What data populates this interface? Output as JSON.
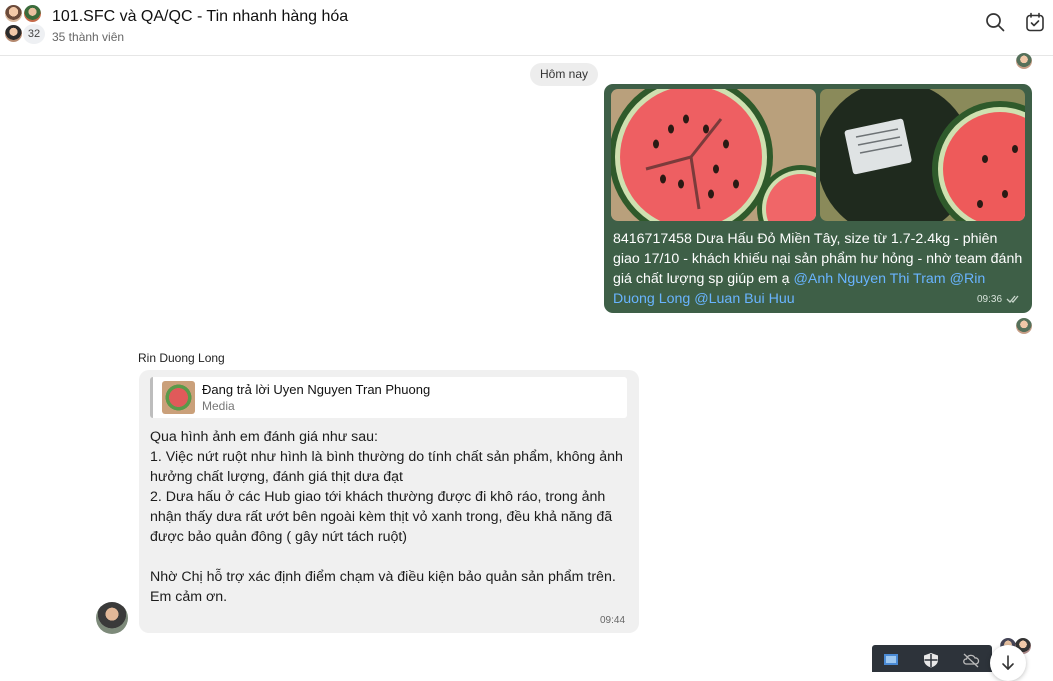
{
  "header": {
    "title": "101.SFC và QA/QC - Tin nhanh hàng hóa",
    "member_count_badge": "32",
    "subtitle": "35 thành viên",
    "icons": [
      "search-icon",
      "calendar-check-icon"
    ]
  },
  "day_separator": "Hôm nay",
  "outgoing_message": {
    "text_before_mention": "8416717458 Dưa Hấu Đỏ Miền Tây, size từ 1.7-2.4kg     - phiên giao 17/10 - khách khiếu nại sản phẩm hư hỏng - nhờ team đánh giá chất lượng sp giúp em ạ ",
    "mentions": "@Anh Nguyen Thi Tram @Rin Duong Long @Luan Bui Huu",
    "time": "09:36",
    "images": [
      "watermelon-cut-photo",
      "watermelon-whole-photo"
    ]
  },
  "incoming_message": {
    "sender": "Rin Duong Long",
    "reply_to_name": "Đang trả lời Uyen Nguyen Tran Phuong",
    "reply_to_type": "Media",
    "text": "Qua hình ảnh em đánh giá như sau:\n1. Việc nứt ruột như hình là bình thường do tính chất sản phẩm, không ảnh hưởng chất lượng, đánh giá thịt dưa đạt\n2. Dưa hấu ở các Hub giao tới khách thường được đi khô ráo, trong ảnh nhận thấy dưa rất ướt bên ngoài kèm thịt vỏ xanh trong, đều khả năng đã được bảo quản đông ( gây nứt tách ruột)\n\nNhờ Chị hỗ trợ xác định điểm chạm và điều kiện bảo quản sản phẩm trên.\nEm cảm ơn.",
    "time": "09:44"
  },
  "colors": {
    "outgoing_bubble": "#3e5f47",
    "mention": "#69b4ff",
    "incoming_bubble": "#f0f0f0"
  }
}
